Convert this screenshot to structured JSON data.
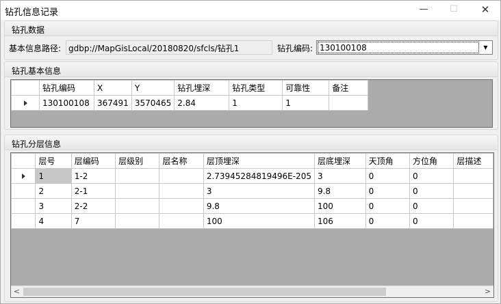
{
  "window": {
    "title": "钻孔信息记录",
    "minimize": "—",
    "maximize": "☐",
    "close": "✕"
  },
  "drill_data": {
    "group_title": "钻孔数据",
    "path_label": "基本信息路径:",
    "path_value": "gdbp://MapGisLocal/20180820/sfcls/钻孔1",
    "code_label": "钻孔编码:",
    "code_value": "130100108"
  },
  "basic_info": {
    "group_title": "钻孔基本信息",
    "columns": [
      "钻孔编码",
      "X",
      "Y",
      "钻孔埋深",
      "钻孔类型",
      "可靠性",
      "备注"
    ],
    "rows": [
      [
        "130100108",
        "367491",
        "3570465",
        "2.84",
        "1",
        "1",
        ""
      ]
    ]
  },
  "layer_info": {
    "group_title": "钻孔分层信息",
    "columns": [
      "层号",
      "层编码",
      "层级别",
      "层名称",
      "层顶埋深",
      "层底埋深",
      "天顶角",
      "方位角",
      "层描述"
    ],
    "rows": [
      [
        "1",
        "1-2",
        "",
        "",
        "2.73945284819496E-205",
        "3",
        "0",
        "0",
        ""
      ],
      [
        "2",
        "2-1",
        "",
        "",
        "3",
        "9.8",
        "0",
        "0",
        ""
      ],
      [
        "3",
        "2-2",
        "",
        "",
        "9.8",
        "100",
        "0",
        "0",
        ""
      ],
      [
        "4",
        "7",
        "",
        "",
        "100",
        "106",
        "0",
        "0",
        ""
      ]
    ],
    "scroll_left": "<",
    "scroll_right": ">"
  }
}
